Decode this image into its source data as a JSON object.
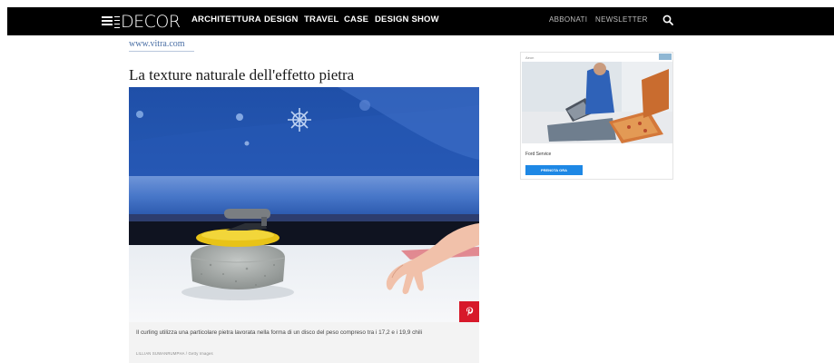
{
  "header": {
    "logo_text": "DECOR",
    "nav_items": [
      "ARCHITETTURA",
      "DESIGN",
      "TRAVEL",
      "CASE",
      "DESIGN SHOW"
    ],
    "right_items": [
      "ABBONATI",
      "NEWSLETTER"
    ],
    "icons": [
      "menu-icon",
      "search-icon"
    ]
  },
  "article": {
    "source_link": "www.vitra.com",
    "headline": "La texture naturale dell'effetto pietra",
    "image_alt_subject": "curling stone on ice",
    "caption": "Il curling utilizza una particolare pietra lavorata nella forma di un disco del peso compreso tra i 17,2 e i 19,9 chili",
    "credit": "LILLIAN SUWANRUMPHA / Getty Images",
    "pin_icon": "pinterest-icon"
  },
  "ad": {
    "label": "Aeon",
    "sponsor": "Ford Service",
    "cta_label": "PRENOTA ORA"
  },
  "colors": {
    "topbar": "#000000",
    "link": "#4a6fa5",
    "pin": "#d7192a",
    "cta": "#1e88e5",
    "caption_bg": "#f3f3f3"
  }
}
